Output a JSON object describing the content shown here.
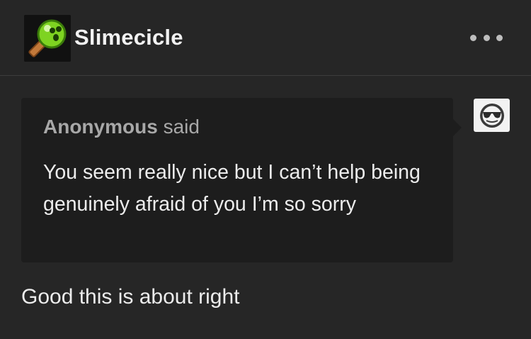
{
  "post": {
    "blog_name": "Slimecicle",
    "more_icon": "ellipsis-horizontal-icon",
    "avatar_icon": "green-slime-popsicle-icon"
  },
  "ask": {
    "asker_name": "Anonymous",
    "said_label": "said",
    "question": "You seem really nice but I can’t help being genuinely afraid of you I’m so sorry",
    "asker_avatar_icon": "anonymous-sunglasses-icon"
  },
  "answer": {
    "text": "Good this is about right"
  },
  "colors": {
    "background": "#262626",
    "ask_box": "#1d1d1d",
    "text_primary": "#ececec",
    "text_muted": "#a8a8a8",
    "slime_green": "#7ed321"
  }
}
